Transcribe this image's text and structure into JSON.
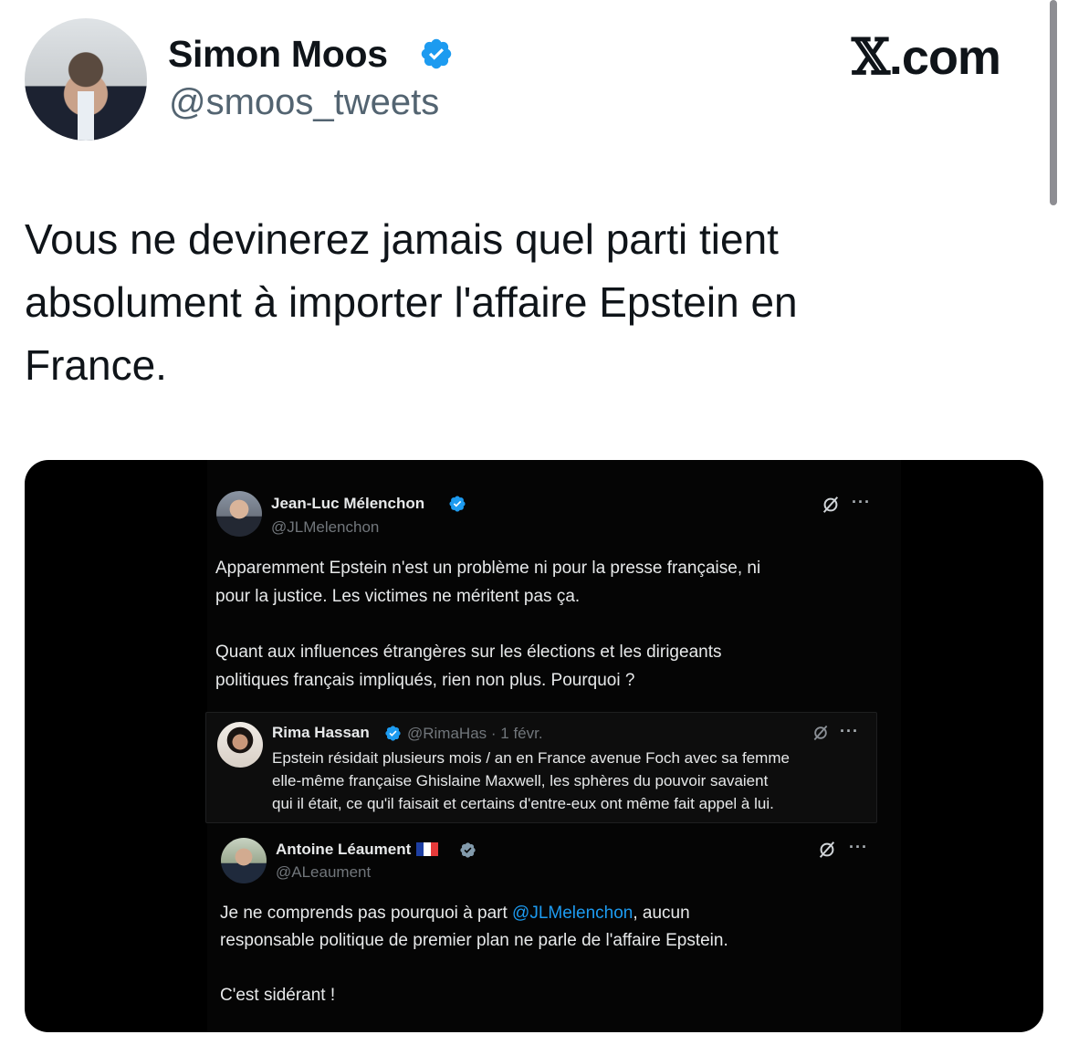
{
  "author": {
    "display_name": "Simon Moos",
    "handle": "@smoos_tweets",
    "verified": true
  },
  "brand": {
    "name": "X.com",
    "x_letter": "𝕏",
    "suffix": ".com"
  },
  "tweet": {
    "lines": [
      "Vous ne devinerez jamais quel parti tient",
      "absolument à importer l'affaire Epstein en",
      "France."
    ]
  },
  "screenshot": {
    "main_post": {
      "name": "Jean-Luc Mélenchon",
      "handle": "@JLMelenchon",
      "lines": [
        "Apparemment Epstein n'est un problème ni pour la presse française, ni",
        "pour la justice. Les victimes ne méritent pas ça.",
        "Quant aux influences étrangères sur les élections et les dirigeants",
        "politiques français impliqués, rien non plus. Pourquoi ?"
      ]
    },
    "quoted_post": {
      "name": "Rima Hassan",
      "handle_date": "@RimaHas · 1 févr.",
      "lines": [
        "Epstein résidait plusieurs mois / an en France avenue Foch avec sa femme",
        "elle-même française Ghislaine Maxwell, les sphères du pouvoir savaient",
        "qui il était, ce qu'il faisait et certains d'entre-eux ont même fait appel à lui."
      ]
    },
    "reply_post": {
      "name": "Antoine Léaument",
      "handle": "@ALeaument",
      "line1_before": "Je ne comprends pas pourquoi à part ",
      "line1_mention": "@JLMelenchon",
      "line1_after": ", aucun",
      "line2": "responsable politique de premier plan ne parle de l'affaire Epstein.",
      "line3": "C'est sidérant !"
    },
    "more_label": "···"
  },
  "colors": {
    "verified_blue": "#1d9bf0",
    "link_blue": "#1d9bf0",
    "gray_verified": "#829aab"
  }
}
